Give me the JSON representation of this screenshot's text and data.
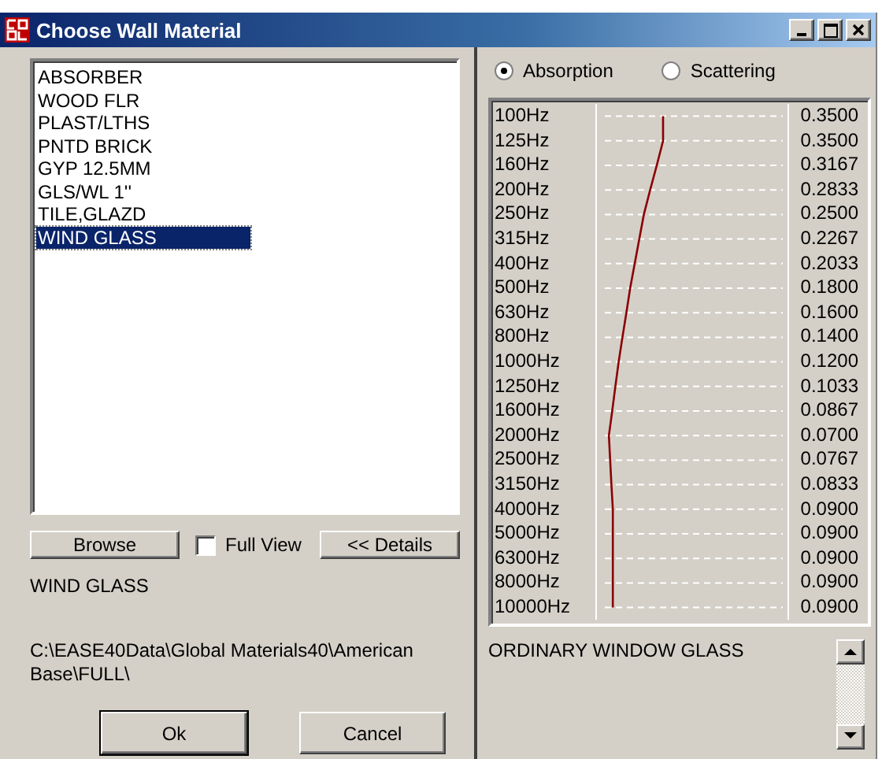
{
  "window": {
    "title": "Choose Wall Material"
  },
  "materials": [
    {
      "name": "ABSORBER",
      "selected": false
    },
    {
      "name": "WOOD FLR",
      "selected": false
    },
    {
      "name": "PLAST/LTHS",
      "selected": false
    },
    {
      "name": "PNTD BRICK",
      "selected": false
    },
    {
      "name": "GYP 12.5MM",
      "selected": false
    },
    {
      "name": "GLS/WL 1''",
      "selected": false
    },
    {
      "name": "TILE,GLAZD",
      "selected": false
    },
    {
      "name": "WIND GLASS",
      "selected": true
    }
  ],
  "browse_button": "Browse",
  "full_view": {
    "label": "Full View",
    "checked": false
  },
  "details_button": "<< Details",
  "selected_name": "WIND GLASS",
  "path": "C:\\EASE40Data\\Global Materials40\\American Base\\FULL\\",
  "buttons": [
    "Ok",
    "Cancel"
  ],
  "modes": [
    {
      "label": "Absorption",
      "selected": true
    },
    {
      "label": "Scattering",
      "selected": false
    }
  ],
  "bands": [
    {
      "frequency": "100Hz",
      "value": "0.3500"
    },
    {
      "frequency": "125Hz",
      "value": "0.3500"
    },
    {
      "frequency": "160Hz",
      "value": "0.3167"
    },
    {
      "frequency": "200Hz",
      "value": "0.2833"
    },
    {
      "frequency": "250Hz",
      "value": "0.2500"
    },
    {
      "frequency": "315Hz",
      "value": "0.2267"
    },
    {
      "frequency": "400Hz",
      "value": "0.2033"
    },
    {
      "frequency": "500Hz",
      "value": "0.1800"
    },
    {
      "frequency": "630Hz",
      "value": "0.1600"
    },
    {
      "frequency": "800Hz",
      "value": "0.1400"
    },
    {
      "frequency": "1000Hz",
      "value": "0.1200"
    },
    {
      "frequency": "1250Hz",
      "value": "0.1033"
    },
    {
      "frequency": "1600Hz",
      "value": "0.0867"
    },
    {
      "frequency": "2000Hz",
      "value": "0.0700"
    },
    {
      "frequency": "2500Hz",
      "value": "0.0767"
    },
    {
      "frequency": "3150Hz",
      "value": "0.0833"
    },
    {
      "frequency": "4000Hz",
      "value": "0.0900"
    },
    {
      "frequency": "5000Hz",
      "value": "0.0900"
    },
    {
      "frequency": "6300Hz",
      "value": "0.0900"
    },
    {
      "frequency": "8000Hz",
      "value": "0.0900"
    },
    {
      "frequency": "10000Hz",
      "value": "0.0900"
    }
  ],
  "description": "ORDINARY WINDOW GLASS"
}
